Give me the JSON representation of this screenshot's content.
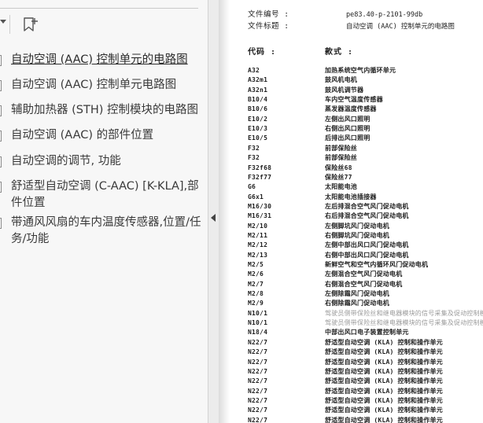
{
  "bookmarks": [
    {
      "label": "自动空调 (AAC) 控制单元的电路图",
      "selected": true
    },
    {
      "label": "自动空调 (AAC) 控制单元电路图",
      "selected": false
    },
    {
      "label": "辅助加热器 (STH) 控制模块的电路图",
      "selected": false
    },
    {
      "label": "自动空调 (AAC) 的部件位置",
      "selected": false
    },
    {
      "label": "自动空调的调节, 功能",
      "selected": false
    },
    {
      "label": "舒适型自动空调 (C-AAC) [K-KLA],部件位置",
      "selected": false
    },
    {
      "label": "带通风风扇的车内温度传感器,位置/任务/功能",
      "selected": false
    }
  ],
  "icons": {
    "dropdown": "chevron-down-icon",
    "bookmark_add": "bookmark-add-icon",
    "collapse": "collapse-left-icon"
  },
  "document": {
    "file_number_label": "文件编号 :",
    "file_number_value": "pe83.40-p-2101-99db",
    "file_title_label": "文件标题 :",
    "file_title_value": "自动空调 (AAC) 控制单元的电路图",
    "col_code": "代码 :",
    "col_name": "款式 :",
    "rows": [
      {
        "code": "A32",
        "name": "加热系统空气内循环单元"
      },
      {
        "code": "A32m1",
        "name": "鼓风机电机"
      },
      {
        "code": "A32n1",
        "name": "鼓风机调节器"
      },
      {
        "code": "B10/4",
        "name": "车内空气温度传感器"
      },
      {
        "code": "B10/6",
        "name": "蒸发器温度传感器"
      },
      {
        "code": "E10/2",
        "name": "左侧出风口照明"
      },
      {
        "code": "E10/3",
        "name": "右侧出风口照明"
      },
      {
        "code": "E10/5",
        "name": "后排出风口照明"
      },
      {
        "code": "F32",
        "name": "前部保险丝"
      },
      {
        "code": "F32",
        "name": "前部保险丝"
      },
      {
        "code": "F32f68",
        "name": "保险丝68"
      },
      {
        "code": "F32f77",
        "name": "保险丝77"
      },
      {
        "code": "G6",
        "name": "太阳能电池"
      },
      {
        "code": "G6x1",
        "name": "太阳能电池插接器"
      },
      {
        "code": "M16/30",
        "name": "左后排混合空气风门促动电机"
      },
      {
        "code": "M16/31",
        "name": "右后排混合空气风门促动电机"
      },
      {
        "code": "M2/10",
        "name": "左侧脚坑风门促动电机"
      },
      {
        "code": "M2/11",
        "name": "右侧脚坑风门促动电机"
      },
      {
        "code": "M2/12",
        "name": "左侧中部出风口风门促动电机"
      },
      {
        "code": "M2/13",
        "name": "右侧中部出风口风门促动电机"
      },
      {
        "code": "M2/5",
        "name": "新鲜空气和空气内循环风门促动电机"
      },
      {
        "code": "M2/6",
        "name": "左侧混合空气风门促动电机"
      },
      {
        "code": "M2/7",
        "name": "右侧混合空气风门促动电机"
      },
      {
        "code": "M2/8",
        "name": "左侧除霜风门促动电机"
      },
      {
        "code": "M2/9",
        "name": "右侧除霜风门促动电机"
      },
      {
        "code": "N10/1",
        "name": "驾驶员侧带保险丝和继电器模块的信号采集及促动控制模块",
        "faint": true
      },
      {
        "code": "N10/1",
        "name": "驾驶员侧带保险丝和继电器模块的信号采集及促动控制模块",
        "faint": true
      },
      {
        "code": "N18/4",
        "name": "中部出风口电子装置控制单元"
      },
      {
        "code": "N22/7",
        "name": "舒适型自动空调 (KLA) 控制和操作单元"
      },
      {
        "code": "N22/7",
        "name": "舒适型自动空调 (KLA) 控制和操作单元"
      },
      {
        "code": "N22/7",
        "name": "舒适型自动空调 (KLA) 控制和操作单元"
      },
      {
        "code": "N22/7",
        "name": "舒适型自动空调 (KLA) 控制和操作单元"
      },
      {
        "code": "N22/7",
        "name": "舒适型自动空调 (KLA) 控制和操作单元"
      },
      {
        "code": "N22/7",
        "name": "舒适型自动空调 (KLA) 控制和操作单元"
      },
      {
        "code": "N22/7",
        "name": "舒适型自动空调 (KLA) 控制和操作单元"
      },
      {
        "code": "N22/7",
        "name": "舒适型自动空调 (KLA) 控制和操作单元"
      },
      {
        "code": "N22/7",
        "name": "舒适型自动空调 (KLA) 控制和操作单元"
      }
    ]
  }
}
